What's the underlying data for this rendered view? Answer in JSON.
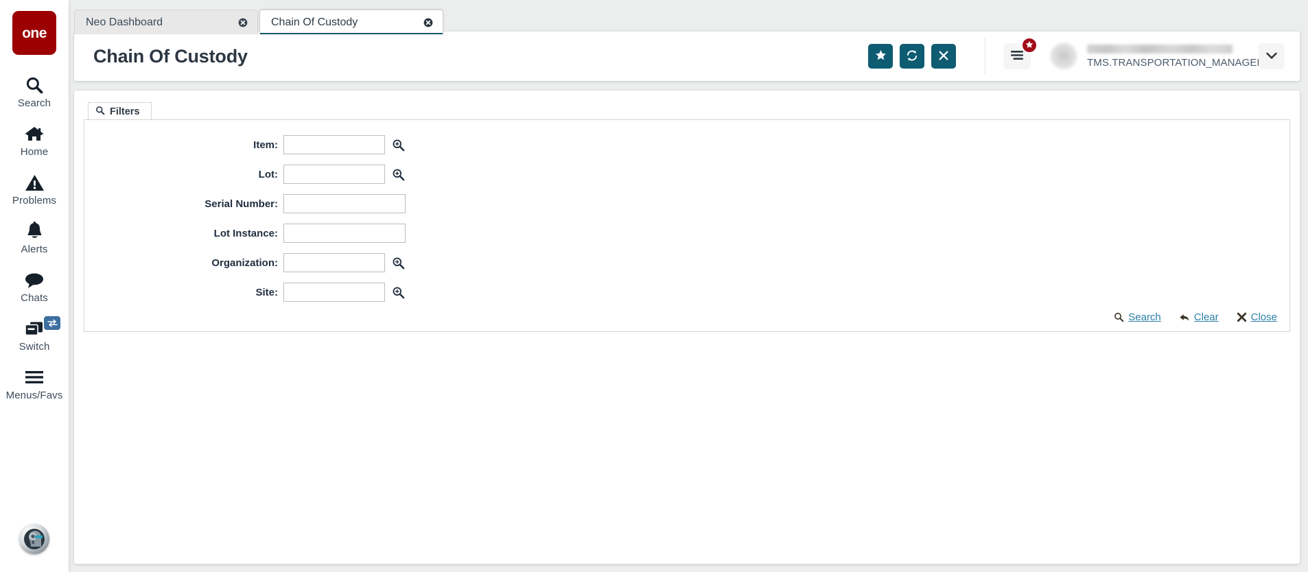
{
  "brand": {
    "logo_text": "one",
    "logo_color": "#9c0000",
    "accent_teal": "#0e5c72",
    "link_blue": "#2d7fa8",
    "badge_red": "#a00c18",
    "switch_badge_blue": "#3c6e9f"
  },
  "rail": {
    "items": [
      {
        "label": "Search",
        "icon": "search-icon"
      },
      {
        "label": "Home",
        "icon": "home-icon"
      },
      {
        "label": "Problems",
        "icon": "warning-triangle-icon"
      },
      {
        "label": "Alerts",
        "icon": "bell-icon"
      },
      {
        "label": "Chats",
        "icon": "chat-bubble-icon"
      },
      {
        "label": "Switch",
        "icon": "windows-stack-icon",
        "badge_icon": "swap-arrows-icon"
      },
      {
        "label": "Menus/Favs",
        "icon": "hamburger-icon"
      }
    ],
    "assistant_icon": "ai-assistant-avatar"
  },
  "tabs": [
    {
      "label": "Neo Dashboard",
      "active": false,
      "close_icon": "close-circle-icon"
    },
    {
      "label": "Chain Of Custody",
      "active": true,
      "close_icon": "close-circle-icon"
    }
  ],
  "header": {
    "title": "Chain Of Custody",
    "buttons": [
      {
        "name": "favorite-button",
        "icon": "star-icon"
      },
      {
        "name": "refresh-button",
        "icon": "refresh-icon"
      },
      {
        "name": "close-button",
        "icon": "x-icon"
      }
    ],
    "menu_icon": "menu-lines-icon",
    "menu_badge_icon": "star-icon",
    "user_role": "TMS.TRANSPORTATION_MANAGER",
    "user_caret_icon": "chevron-down-icon",
    "avatar_icon": "avatar"
  },
  "panel": {
    "tab_label": "Filters",
    "tab_icon": "search-icon",
    "fields": [
      {
        "label": "Item:",
        "value": "",
        "placeholder": "",
        "width": "short",
        "lookup": true,
        "name": "item-field"
      },
      {
        "label": "Lot:",
        "value": "",
        "placeholder": "",
        "width": "short",
        "lookup": true,
        "name": "lot-field"
      },
      {
        "label": "Serial Number:",
        "value": "",
        "placeholder": "",
        "width": "long",
        "lookup": false,
        "name": "serial-number-field"
      },
      {
        "label": "Lot Instance:",
        "value": "",
        "placeholder": "",
        "width": "long",
        "lookup": false,
        "name": "lot-instance-field"
      },
      {
        "label": "Organization:",
        "value": "",
        "placeholder": "",
        "width": "short",
        "lookup": true,
        "name": "organization-field"
      },
      {
        "label": "Site:",
        "value": "",
        "placeholder": "",
        "width": "short",
        "lookup": true,
        "name": "site-field"
      }
    ],
    "actions": [
      {
        "label": "Search",
        "icon": "search-icon",
        "name": "search-link"
      },
      {
        "label": "Clear",
        "icon": "back-arrow-icon",
        "name": "clear-link"
      },
      {
        "label": "Close",
        "icon": "x-bold-icon",
        "name": "close-link"
      }
    ]
  }
}
